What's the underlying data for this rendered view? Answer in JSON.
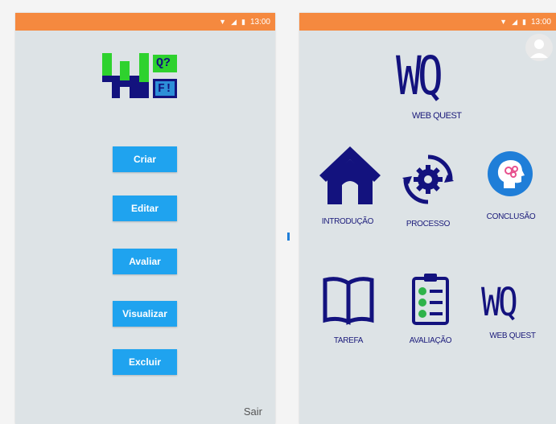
{
  "left_screen": {
    "status_time": "13:00",
    "logo": {
      "q_label": "Q?",
      "f_label": "F!"
    },
    "buttons": [
      "Criar",
      "Editar",
      "Avaliar",
      "Visualizar",
      "Excluir"
    ],
    "exit_label": "Sair"
  },
  "right_screen": {
    "status_time": "13:00",
    "header": {
      "logo_text": "WQ",
      "caption": "WEB QUEST"
    },
    "nav": [
      {
        "label": "INTRODUÇÃO",
        "icon": "house-icon"
      },
      {
        "label": "PROCESSO",
        "icon": "gear-cycle-icon"
      },
      {
        "label": "CONCLUSÃO",
        "icon": "head-idea-icon"
      },
      {
        "label": "TAREFA",
        "icon": "book-icon"
      },
      {
        "label": "AVALIAÇÃO",
        "icon": "checklist-icon"
      },
      {
        "label": "WEB QUEST",
        "icon": "wq-logo-icon"
      }
    ]
  },
  "colors": {
    "status_bar": "#f5893f",
    "button": "#1fa3ef",
    "icon_navy": "#13127e",
    "screen_bg": "#dde3e6"
  }
}
